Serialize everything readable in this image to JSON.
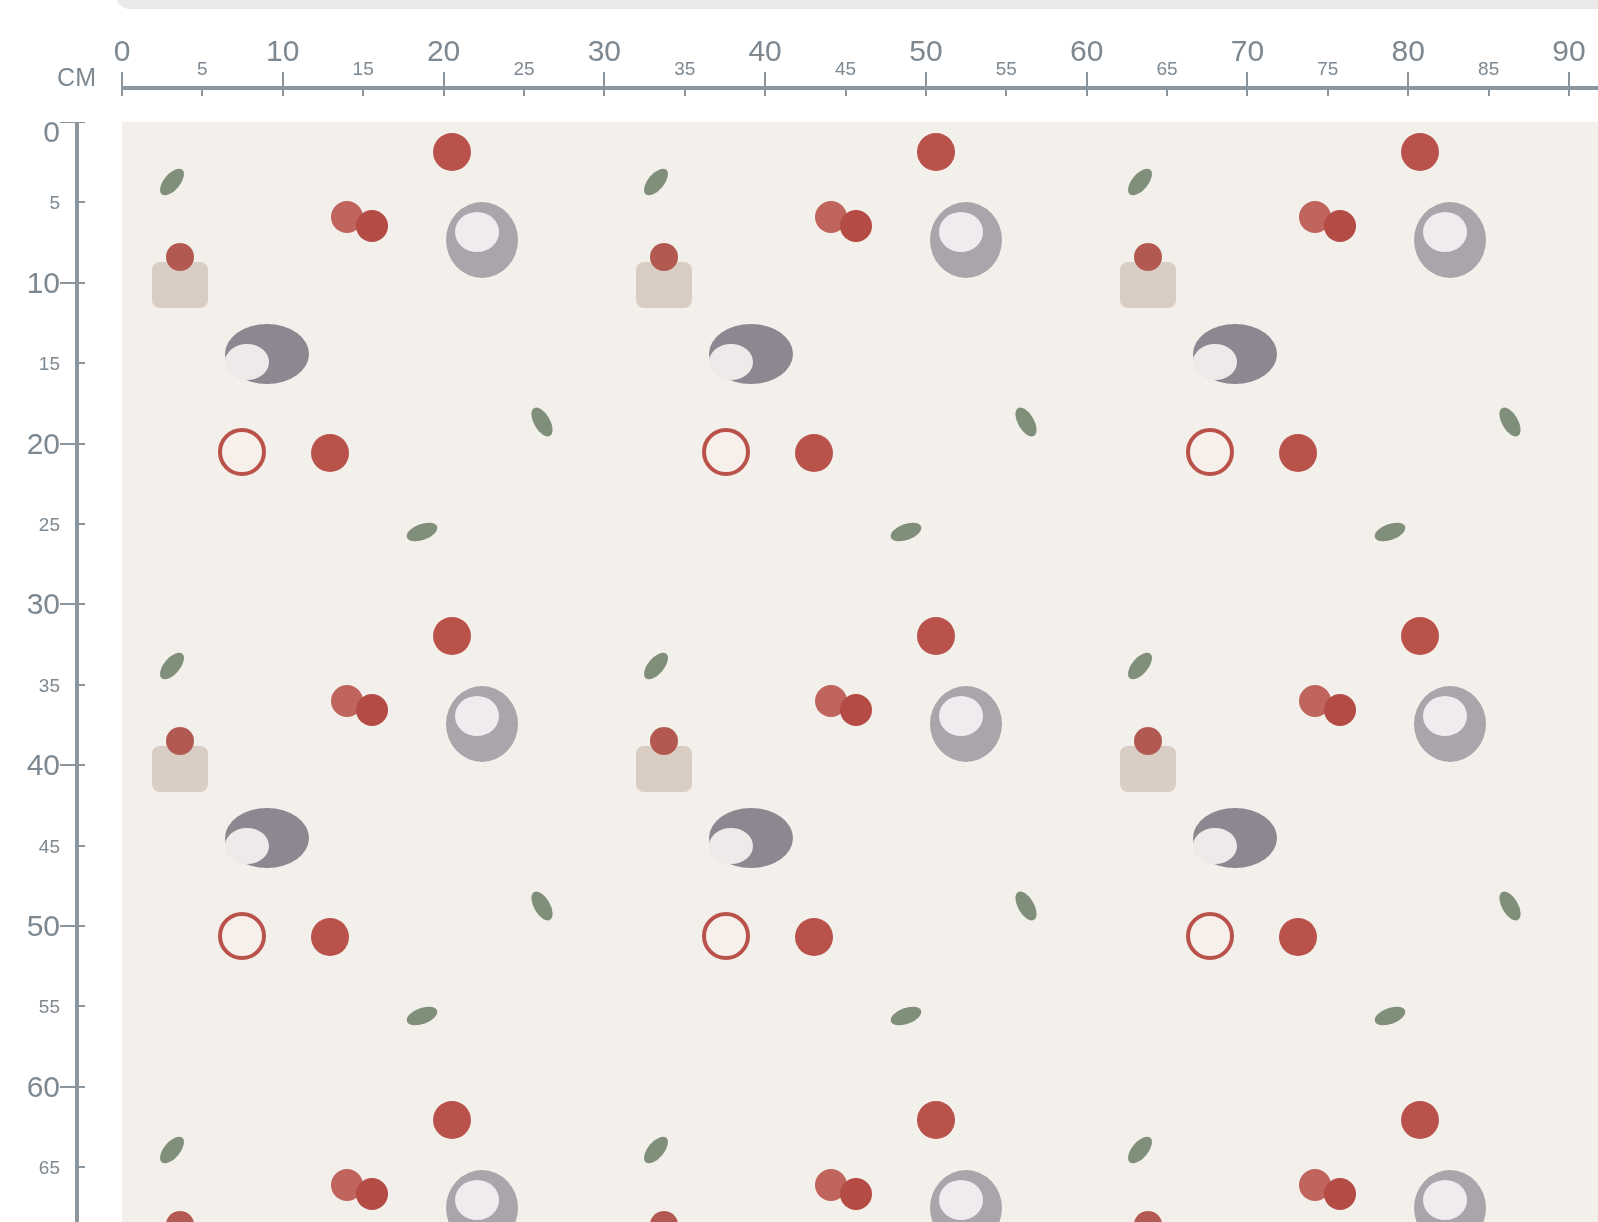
{
  "unit_label": "CM",
  "top_ruler": {
    "labels": [
      {
        "text": "0",
        "kind": "major"
      },
      {
        "text": "5",
        "kind": "minor"
      },
      {
        "text": "10",
        "kind": "major"
      },
      {
        "text": "15",
        "kind": "minor"
      },
      {
        "text": "20",
        "kind": "major"
      },
      {
        "text": "25",
        "kind": "minor"
      },
      {
        "text": "30",
        "kind": "major"
      },
      {
        "text": "35",
        "kind": "minor"
      },
      {
        "text": "40",
        "kind": "major"
      },
      {
        "text": "45",
        "kind": "minor"
      },
      {
        "text": "50",
        "kind": "major"
      },
      {
        "text": "55",
        "kind": "minor"
      },
      {
        "text": "60",
        "kind": "major"
      },
      {
        "text": "65",
        "kind": "minor"
      },
      {
        "text": "70",
        "kind": "major"
      },
      {
        "text": "75",
        "kind": "minor"
      },
      {
        "text": "80",
        "kind": "major"
      },
      {
        "text": "85",
        "kind": "minor"
      },
      {
        "text": "90",
        "kind": "major"
      }
    ]
  },
  "left_ruler": {
    "labels": [
      {
        "text": "0",
        "kind": "major"
      },
      {
        "text": "5",
        "kind": "minor"
      },
      {
        "text": "10",
        "kind": "major"
      },
      {
        "text": "15",
        "kind": "minor"
      },
      {
        "text": "20",
        "kind": "major"
      },
      {
        "text": "25",
        "kind": "minor"
      },
      {
        "text": "30",
        "kind": "major"
      },
      {
        "text": "35",
        "kind": "minor"
      },
      {
        "text": "40",
        "kind": "major"
      },
      {
        "text": "45",
        "kind": "minor"
      },
      {
        "text": "50",
        "kind": "major"
      },
      {
        "text": "55",
        "kind": "minor"
      },
      {
        "text": "60",
        "kind": "major"
      },
      {
        "text": "65",
        "kind": "minor"
      }
    ]
  }
}
